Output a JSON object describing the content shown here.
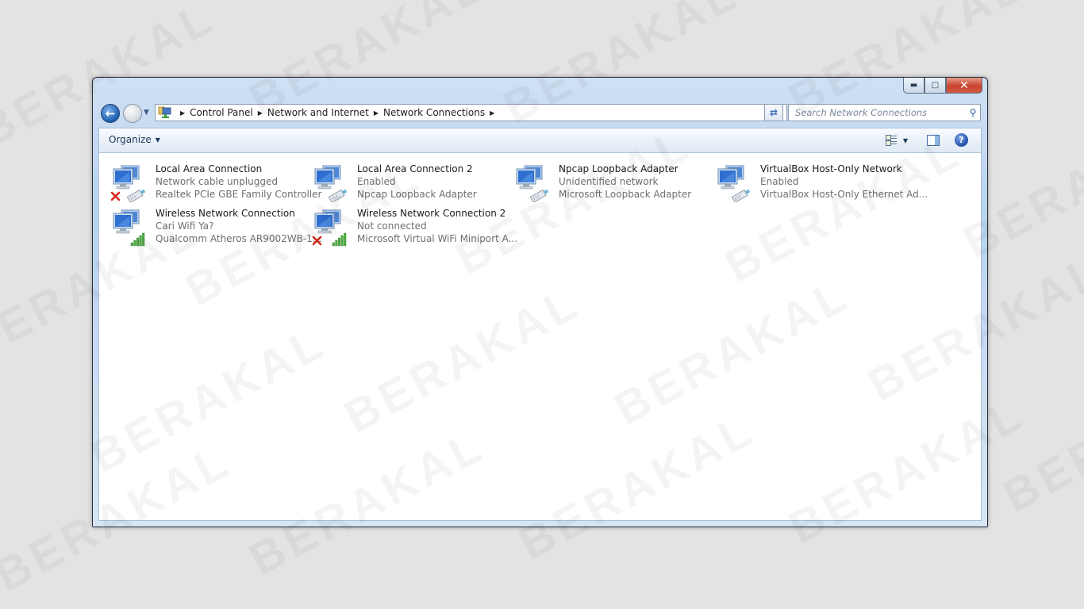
{
  "window": {
    "caption_buttons": {
      "minimize": "minimize-icon",
      "maximize": "maximize-icon",
      "close": "close-icon"
    }
  },
  "navigation": {
    "back_icon": "back-arrow-icon",
    "forward_icon": "forward-arrow-icon",
    "recent_icon": "chevron-down-icon",
    "breadcrumb": [
      "Control Panel",
      "Network and Internet",
      "Network Connections"
    ],
    "refresh_icon": "refresh-icon",
    "search_placeholder": "Search Network Connections"
  },
  "toolbar": {
    "organize_label": "Organize",
    "view_icon": "change-view-icon",
    "preview_icon": "preview-pane-icon",
    "help_icon": "help-icon"
  },
  "connections": [
    {
      "name": "Local Area Connection",
      "status": "Network cable unplugged",
      "device": "Realtek PCIe GBE Family Controller",
      "type": "ethernet",
      "disconnected": true
    },
    {
      "name": "Local Area Connection 2",
      "status": "Enabled",
      "device": "Npcap Loopback Adapter",
      "type": "ethernet",
      "disconnected": false
    },
    {
      "name": "Npcap Loopback Adapter",
      "status": "Unidentified network",
      "device": "Microsoft Loopback Adapter",
      "type": "ethernet",
      "disconnected": false
    },
    {
      "name": "VirtualBox Host-Only Network",
      "status": "Enabled",
      "device": "VirtualBox Host-Only Ethernet Ad...",
      "type": "ethernet",
      "disconnected": false
    },
    {
      "name": "Wireless Network Connection",
      "status": "Cari Wifi Ya?",
      "device": "Qualcomm Atheros AR9002WB-1...",
      "type": "wireless",
      "disconnected": false
    },
    {
      "name": "Wireless Network Connection 2",
      "status": "Not connected",
      "device": "Microsoft Virtual WiFi Miniport A...",
      "type": "wireless",
      "disconnected": true
    }
  ],
  "watermark": "BERAKAL"
}
